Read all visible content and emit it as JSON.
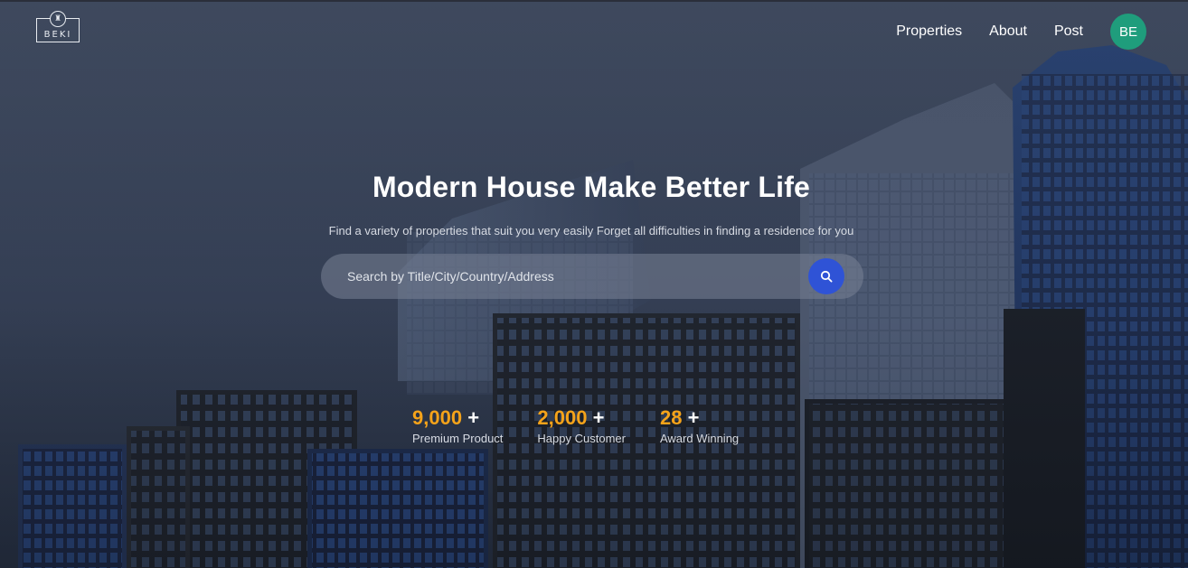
{
  "brand": {
    "logo_text": "BEKI"
  },
  "nav": {
    "items": [
      {
        "label": "Properties"
      },
      {
        "label": "About"
      },
      {
        "label": "Post"
      }
    ],
    "avatar_initials": "BE",
    "avatar_color": "#1f9d7c"
  },
  "hero": {
    "title": "Modern House Make Better Life",
    "subtitle": "Find a variety of properties that suit you very easily Forget all difficulties in finding a residence for you"
  },
  "search": {
    "placeholder": "Search by Title/City/Country/Address",
    "value": "",
    "button_icon": "search-icon",
    "button_color": "#2f53d6"
  },
  "stats": [
    {
      "value": "9,000",
      "suffix": "+",
      "label": "Premium Product"
    },
    {
      "value": "2,000",
      "suffix": "+",
      "label": "Happy Customer"
    },
    {
      "value": "28",
      "suffix": "+",
      "label": "Award Winning"
    }
  ],
  "colors": {
    "accent": "#f5a31a",
    "overlay": "#3b475d"
  }
}
